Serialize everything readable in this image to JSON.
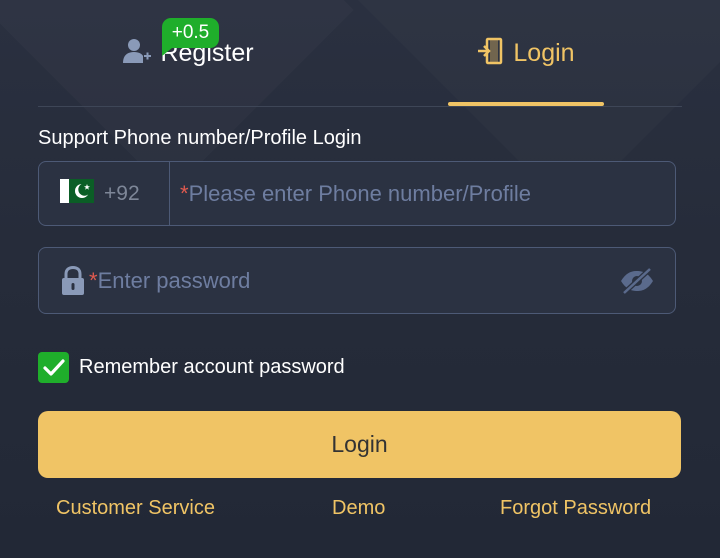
{
  "tabs": {
    "register_label": "Register",
    "login_label": "Login",
    "bonus_badge": "+0.5",
    "active": "login"
  },
  "support_text": "Support Phone number/Profile Login",
  "phone_field": {
    "country_flag": "pakistan-flag",
    "country_code": "+92",
    "required_mark": "*",
    "placeholder": "Please enter Phone number/Profile"
  },
  "password_field": {
    "required_mark": "*",
    "placeholder": "Enter password"
  },
  "remember": {
    "label": "Remember account password",
    "checked": true
  },
  "login_button": "Login",
  "footer": {
    "customer_service": "Customer Service",
    "demo": "Demo",
    "forgot_password": "Forgot Password"
  },
  "colors": {
    "accent": "#f0c465",
    "success": "#1fae2b",
    "required": "#e05a4f",
    "background": "#262c3a"
  }
}
